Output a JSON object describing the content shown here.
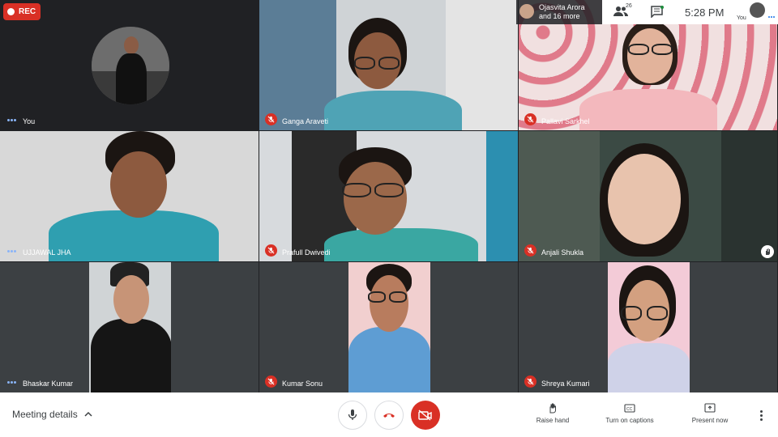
{
  "recording": {
    "label": "REC"
  },
  "top": {
    "others_line1": "Ojasvita Arora",
    "others_line2": "and 16 more",
    "people_count": "26",
    "clock": "5:28  PM",
    "self_label": "You"
  },
  "participants": [
    {
      "name": "You",
      "muted": false
    },
    {
      "name": "Ganga Araveti",
      "muted": true
    },
    {
      "name": "Pallavi Sarkhel",
      "muted": true
    },
    {
      "name": "UJJAWAL JHA",
      "muted": false
    },
    {
      "name": "Prafull Dwivedi",
      "muted": true
    },
    {
      "name": "Anjali Shukla",
      "muted": true
    },
    {
      "name": "Bhaskar Kumar",
      "muted": false
    },
    {
      "name": "Kumar Sonu",
      "muted": true
    },
    {
      "name": "Shreya Kumari",
      "muted": true
    }
  ],
  "bottom": {
    "meeting_details": "Meeting details",
    "raise_hand": "Raise hand",
    "captions": "Turn on captions",
    "present": "Present now"
  },
  "colors": {
    "accent": "#1a73e8",
    "danger": "#d93025",
    "tile_bg": "#3c4043"
  }
}
